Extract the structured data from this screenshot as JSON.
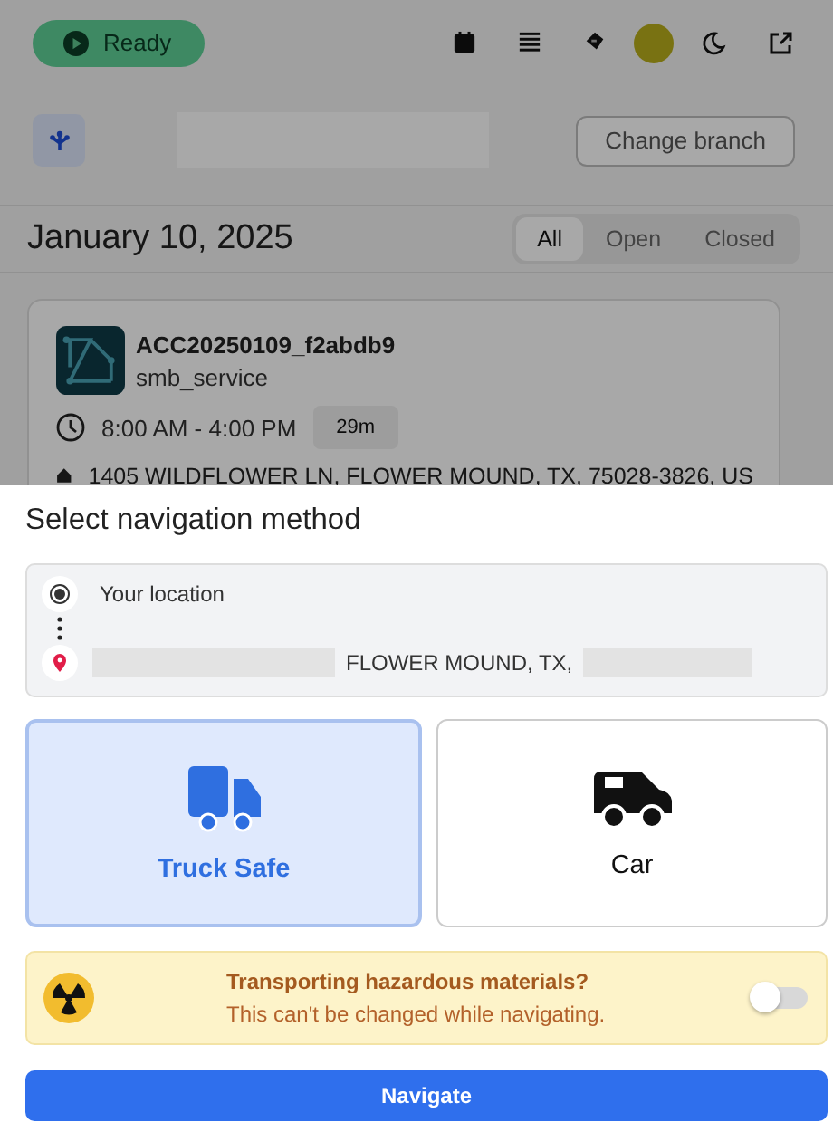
{
  "status": {
    "label": "Ready"
  },
  "branch": {
    "button": "Change branch"
  },
  "date": "January 10, 2025",
  "filters": [
    {
      "label": "All",
      "selected": true
    },
    {
      "label": "Open",
      "selected": false
    },
    {
      "label": "Closed",
      "selected": false
    }
  ],
  "job": {
    "id": "ACC20250109_f2abdb9",
    "service": "smb_service",
    "time": "8:00 AM - 4:00 PM",
    "duration": "29m",
    "address": "1405 WILDFLOWER LN, FLOWER MOUND, TX, 75028-3826, US"
  },
  "sheet": {
    "title": "Select navigation method",
    "origin": "Your location",
    "destination": "FLOWER MOUND, TX,",
    "methods": [
      {
        "kind": "truck",
        "label": "Truck Safe",
        "selected": true
      },
      {
        "kind": "car",
        "label": "Car",
        "selected": false
      }
    ],
    "hazmat": {
      "title": "Transporting hazardous materials?",
      "note": "This can't be changed while navigating.",
      "on": false
    },
    "button": "Navigate"
  }
}
